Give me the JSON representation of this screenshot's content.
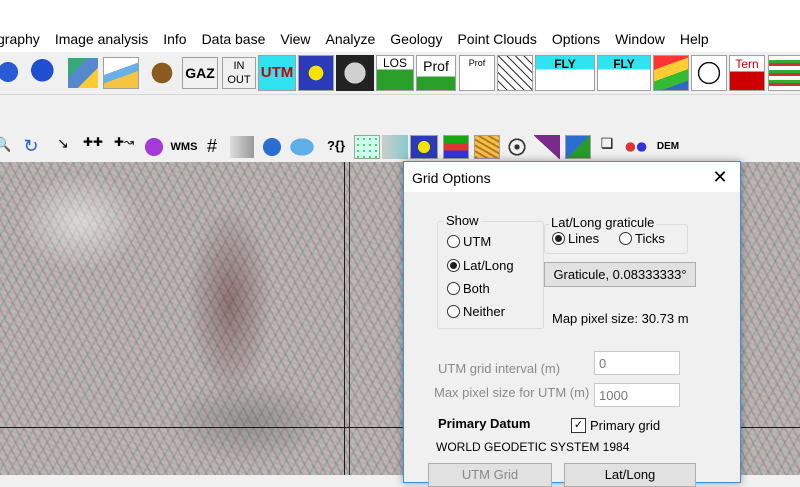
{
  "menu": [
    "graphy",
    "Image analysis",
    "Info",
    "Data base",
    "View",
    "Analyze",
    "Geology",
    "Point Clouds",
    "Options",
    "Window",
    "Help"
  ],
  "toolbar1": {
    "gaz": "GAZ",
    "in_out_top": "IN",
    "in_out_bottom": "OUT",
    "utm": "UTM",
    "los": "LOS",
    "prof": "Prof",
    "prof_small": "Prof",
    "fly": "FLY",
    "fly2": "FLY",
    "tern": "Tern"
  },
  "toolbar2": {
    "wms": "WMS",
    "dem": "DEM",
    "bracket": "?{}"
  },
  "dialog": {
    "title": "Grid Options",
    "show_label": "Show",
    "show_options": [
      "UTM",
      "Lat/Long",
      "Both",
      "Neither"
    ],
    "show_selected": "Lat/Long",
    "graticule_label": "Lat/Long graticule",
    "graticule_options": [
      "Lines",
      "Ticks"
    ],
    "graticule_selected": "Lines",
    "graticule_button": "Graticule, 0.08333333°",
    "map_pixel_size": "Map pixel size: 30.73 m",
    "utm_interval_label": "UTM grid interval (m)",
    "utm_interval_value": "0",
    "max_pixel_label": "Max pixel size for UTM (m)",
    "max_pixel_value": "1000",
    "primary_datum_label": "Primary Datum",
    "primary_grid_label": "Primary grid",
    "primary_grid_checked": true,
    "datum_name": "WORLD GEODETIC SYSTEM 1984",
    "utm_grid_button": "UTM Grid",
    "latlong_button": "Lat/Long"
  }
}
